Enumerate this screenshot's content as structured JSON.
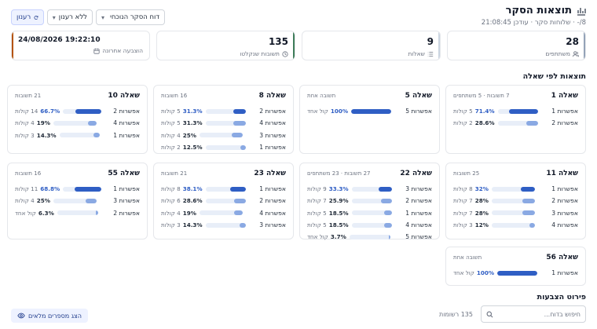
{
  "header": {
    "title": "תוצאות הסקר",
    "subtitle": "8/- · שלוחות סקר · עודכן 21:08:45"
  },
  "controls": {
    "report": "דוח הסקר הנוכחי",
    "filter": "ללא רענון",
    "refresh": "רענון"
  },
  "stats": [
    {
      "value": "28",
      "label": "משתתפים",
      "icon": "users-icon"
    },
    {
      "value": "9",
      "label": "שאלות",
      "icon": "list-icon"
    },
    {
      "value": "135",
      "label": "תשובות שנקלטו",
      "icon": "clock-icon"
    },
    {
      "value": "24/08/2026 19:22:10",
      "label": "הוצבעה אחרונה",
      "icon": "calendar-icon"
    }
  ],
  "sections": {
    "by_question": "תוצאות לפי שאלה",
    "breakdown": "פירוט הצבעות"
  },
  "questions": [
    {
      "title": "שאלה 1",
      "meta": "7 תשובות · 5 משתתפים",
      "options": [
        {
          "label": "אפשרות 1",
          "pct": "71.4%",
          "votes": "5 קולות",
          "value": 71.4
        },
        {
          "label": "אפשרות 2",
          "pct": "28.6%",
          "votes": "2 קולות",
          "value": 28.6
        }
      ]
    },
    {
      "title": "שאלה 5",
      "meta": "תשובה אחת",
      "options": [
        {
          "label": "אפשרות 5",
          "pct": "100%",
          "votes": "קול אחד",
          "value": 100
        }
      ]
    },
    {
      "title": "שאלה 8",
      "meta": "16 תשובות",
      "options": [
        {
          "label": "אפשרות 2",
          "pct": "31.3%",
          "votes": "5 קולות",
          "value": 31.3
        },
        {
          "label": "אפשרות 4",
          "pct": "31.3%",
          "votes": "5 קולות",
          "value": 31.3
        },
        {
          "label": "אפשרות 3",
          "pct": "25%",
          "votes": "4 קולות",
          "value": 25
        },
        {
          "label": "אפשרות 1",
          "pct": "12.5%",
          "votes": "2 קולות",
          "value": 12.5
        }
      ]
    },
    {
      "title": "שאלה 10",
      "meta": "21 תשובות",
      "options": [
        {
          "label": "אפשרות 2",
          "pct": "66.7%",
          "votes": "14 קולות",
          "value": 66.7
        },
        {
          "label": "אפשרות 4",
          "pct": "19%",
          "votes": "4 קולות",
          "value": 19
        },
        {
          "label": "אפשרות 1",
          "pct": "14.3%",
          "votes": "3 קולות",
          "value": 14.3
        }
      ]
    },
    {
      "title": "שאלה 11",
      "meta": "25 תשובות",
      "options": [
        {
          "label": "אפשרות 1",
          "pct": "32%",
          "votes": "8 קולות",
          "value": 32
        },
        {
          "label": "אפשרות 2",
          "pct": "28%",
          "votes": "7 קולות",
          "value": 28
        },
        {
          "label": "אפשרות 3",
          "pct": "28%",
          "votes": "7 קולות",
          "value": 28
        },
        {
          "label": "אפשרות 4",
          "pct": "12%",
          "votes": "3 קולות",
          "value": 12
        }
      ]
    },
    {
      "title": "שאלה 22",
      "meta": "27 תשובות · 23 משתתפים",
      "options": [
        {
          "label": "אפשרות 3",
          "pct": "33.3%",
          "votes": "9 קולות",
          "value": 33.3
        },
        {
          "label": "אפשרות 2",
          "pct": "25.9%",
          "votes": "7 קולות",
          "value": 25.9
        },
        {
          "label": "אפשרות 1",
          "pct": "18.5%",
          "votes": "5 קולות",
          "value": 18.5
        },
        {
          "label": "אפשרות 4",
          "pct": "18.5%",
          "votes": "5 קולות",
          "value": 18.5
        },
        {
          "label": "אפשרות 5",
          "pct": "3.7%",
          "votes": "קול אחד",
          "value": 3.7
        }
      ]
    },
    {
      "title": "שאלה 23",
      "meta": "21 תשובות",
      "options": [
        {
          "label": "אפשרות 1",
          "pct": "38.1%",
          "votes": "8 קולות",
          "value": 38.1
        },
        {
          "label": "אפשרות 2",
          "pct": "28.6%",
          "votes": "6 קולות",
          "value": 28.6
        },
        {
          "label": "אפשרות 4",
          "pct": "19%",
          "votes": "4 קולות",
          "value": 19
        },
        {
          "label": "אפשרות 3",
          "pct": "14.3%",
          "votes": "3 קולות",
          "value": 14.3
        }
      ]
    },
    {
      "title": "שאלה 55",
      "meta": "16 תשובות",
      "options": [
        {
          "label": "אפשרות 1",
          "pct": "68.8%",
          "votes": "11 קולות",
          "value": 68.8
        },
        {
          "label": "אפשרות 3",
          "pct": "25%",
          "votes": "4 קולות",
          "value": 25
        },
        {
          "label": "אפשרות 2",
          "pct": "6.3%",
          "votes": "קול אחד",
          "value": 6.3
        }
      ]
    },
    {
      "title": "שאלה 56",
      "meta": "תשובה אחת",
      "options": [
        {
          "label": "אפשרות 1",
          "pct": "100%",
          "votes": "קול אחד",
          "value": 100
        }
      ]
    }
  ],
  "footer": {
    "search_placeholder": "חיפוש בדוח...",
    "record_count": "135 רשומות",
    "show_full": "הצג מספרים מלאים"
  },
  "colors": {
    "bar_top": "#2f5ec4",
    "bar_other": "#8aa9e3",
    "bar_track": "#e8eef8"
  }
}
